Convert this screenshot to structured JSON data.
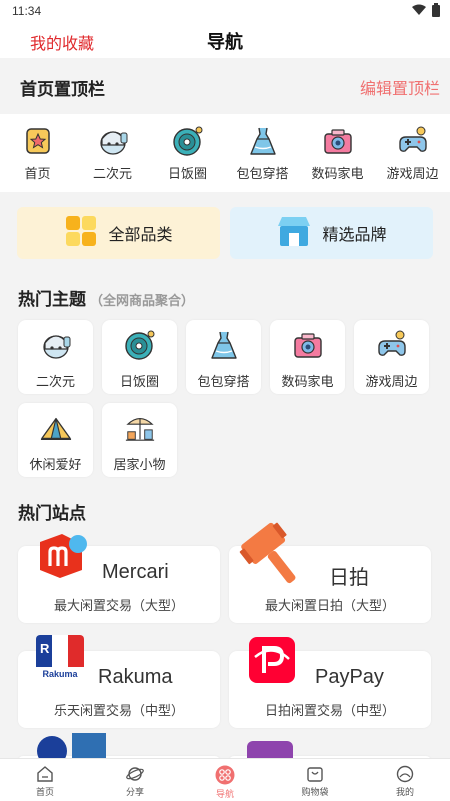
{
  "status": {
    "time": "11:34"
  },
  "header": {
    "left_link": "我的收藏",
    "title": "导航"
  },
  "pinned": {
    "title": "首页置顶栏",
    "edit_label": "编辑置顶栏",
    "items": [
      {
        "label": "首页",
        "icon": "star-home-icon"
      },
      {
        "label": "二次元",
        "icon": "anime-girl-icon"
      },
      {
        "label": "日饭圈",
        "icon": "record-disc-icon"
      },
      {
        "label": "包包穿搭",
        "icon": "dress-icon"
      },
      {
        "label": "数码家电",
        "icon": "camera-icon"
      },
      {
        "label": "游戏周边",
        "icon": "gamepad-icon"
      }
    ]
  },
  "categories": [
    {
      "label": "全部品类",
      "icon": "grid-blocks-icon"
    },
    {
      "label": "精选品牌",
      "icon": "storefront-icon"
    }
  ],
  "hot_topics": {
    "title": "热门主题",
    "subtitle": "（全网商品聚合）",
    "items": [
      {
        "label": "二次元",
        "icon": "anime-girl-icon"
      },
      {
        "label": "日饭圈",
        "icon": "record-disc-icon"
      },
      {
        "label": "包包穿搭",
        "icon": "dress-icon"
      },
      {
        "label": "数码家电",
        "icon": "camera-icon"
      },
      {
        "label": "游戏周边",
        "icon": "gamepad-icon"
      },
      {
        "label": "休闲爱好",
        "icon": "tent-icon"
      },
      {
        "label": "居家小物",
        "icon": "home-goods-icon"
      }
    ]
  },
  "hot_sites": {
    "title": "热门站点",
    "items": [
      {
        "name": "Mercari",
        "desc": "最大闲置交易（大型）",
        "logo": "mercari-logo"
      },
      {
        "name": "日拍",
        "desc": "最大闲置日拍（大型）",
        "logo": "auction-hammer-logo"
      },
      {
        "name": "Rakuma",
        "desc": "乐天闲置交易（中型）",
        "logo": "rakuma-logo",
        "logo_text": "Rakuma",
        "logo_letter": "R"
      },
      {
        "name": "PayPay",
        "desc": "日拍闲置交易（中型）",
        "logo": "paypay-logo"
      }
    ]
  },
  "tabbar": [
    {
      "label": "首页",
      "icon": "home-tab-icon",
      "active": false
    },
    {
      "label": "分享",
      "icon": "share-planet-icon",
      "active": false
    },
    {
      "label": "导航",
      "icon": "nav-grid-icon",
      "active": true
    },
    {
      "label": "购物袋",
      "icon": "shopping-bag-icon",
      "active": false
    },
    {
      "label": "我的",
      "icon": "profile-icon",
      "active": false
    }
  ],
  "colors": {
    "accent_red": "#e0292c",
    "accent_pink": "#f07070",
    "mercari_red": "#e8311c",
    "paypay_red": "#ff0033"
  }
}
